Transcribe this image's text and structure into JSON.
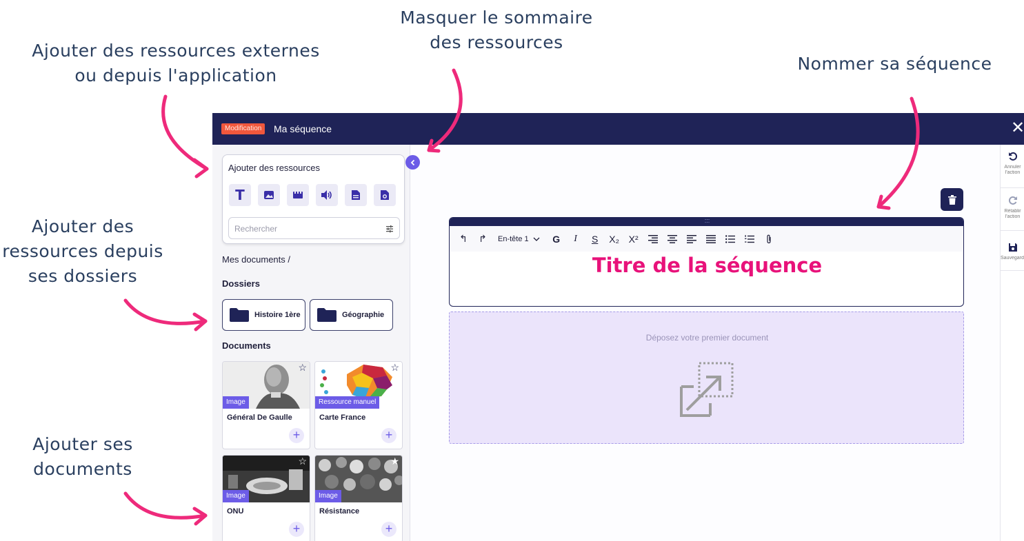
{
  "annotations": {
    "add_resources": [
      "Ajouter des ressources externes",
      "ou depuis l'application"
    ],
    "hide_summary": [
      "Masquer le sommaire",
      "des ressources"
    ],
    "name_sequence": "Nommer sa séquence",
    "from_folders": [
      "Ajouter des",
      "ressources depuis",
      "ses dossiers"
    ],
    "add_documents": [
      "Ajouter ses",
      "documents"
    ],
    "arrow_color": "#ee2a7b"
  },
  "topbar": {
    "mode_badge": "Modification",
    "title": "Ma séquence",
    "close_icon": "close-icon",
    "background": "#1f2357"
  },
  "sidebar": {
    "resources": {
      "title": "Ajouter des ressources",
      "icons": [
        "text-icon",
        "image-icon",
        "video-icon",
        "audio-icon",
        "document-icon",
        "resource-icon"
      ],
      "search_placeholder": "Rechercher"
    },
    "breadcrumb": "Mes documents /",
    "folders_title": "Dossiers",
    "folders": [
      {
        "label": "Histoire 1ère"
      },
      {
        "label": "Géographie"
      }
    ],
    "documents_title": "Documents",
    "documents": [
      {
        "tag": "Image",
        "name": "Général De Gaulle",
        "starred": false
      },
      {
        "tag": "Ressource manuel",
        "name": "Carte France",
        "starred": false
      },
      {
        "tag": "Image",
        "name": "ONU",
        "starred": false
      },
      {
        "tag": "Image",
        "name": "Résistance",
        "starred": true
      }
    ]
  },
  "editor": {
    "handle": ":::",
    "toolbar": {
      "undo": "↰",
      "redo": "↱",
      "heading": "En-tête 1",
      "bold": "G",
      "italic": "I",
      "strike": "S",
      "subscript": "X₂",
      "superscript": "X²"
    },
    "title": "Titre de la séquence",
    "title_color": "#e8127a"
  },
  "dropzone": {
    "text": "Déposez votre premier document"
  },
  "rightbar": {
    "undo_label": [
      "Annuler",
      "l'action"
    ],
    "redo_label": [
      "Rétablir",
      "l'action"
    ],
    "save_label": "Sauvegarder"
  },
  "accent": "#6c5ce7"
}
